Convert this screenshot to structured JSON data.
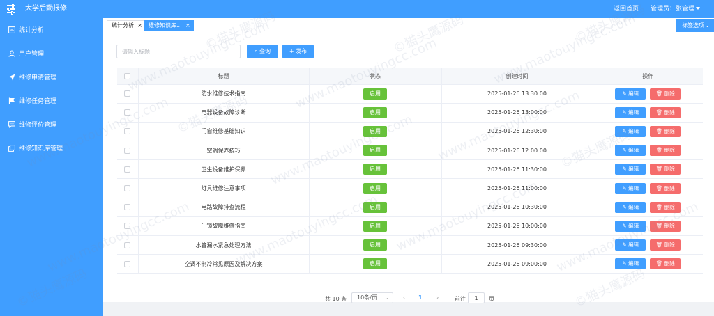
{
  "header": {
    "app_title": "大学后勤报修",
    "home_link": "返回首页",
    "user_menu": "管理员：张管理"
  },
  "sidebar": {
    "items": [
      {
        "label": "统计分析",
        "icon": "chart-box-icon"
      },
      {
        "label": "用户管理",
        "icon": "user-icon"
      },
      {
        "label": "维修申请管理",
        "icon": "send-icon"
      },
      {
        "label": "维修任务管理",
        "icon": "flag-icon"
      },
      {
        "label": "维修评价管理",
        "icon": "comment-icon"
      },
      {
        "label": "维修知识库管理",
        "icon": "copy-icon"
      }
    ]
  },
  "tabs": {
    "items": [
      {
        "label": "统计分析",
        "close": "×",
        "active": false
      },
      {
        "label": "维修知识库...",
        "close": "×",
        "active": true
      }
    ],
    "options_label": "标签选项"
  },
  "toolbar": {
    "search_placeholder": "请输入标题",
    "search_button": "查询",
    "publish_button": "发布"
  },
  "table": {
    "columns": [
      "标题",
      "状态",
      "创建时间",
      "操作"
    ],
    "edit_label": "编辑",
    "delete_label": "删除",
    "rows": [
      {
        "title": "防水维修技术指南",
        "status": "启用",
        "created": "2025-01-26 13:30:00"
      },
      {
        "title": "电器设备故障诊断",
        "status": "启用",
        "created": "2025-01-26 13:00:00"
      },
      {
        "title": "门窗维修基础知识",
        "status": "启用",
        "created": "2025-01-26 12:30:00"
      },
      {
        "title": "空调保养技巧",
        "status": "启用",
        "created": "2025-01-26 12:00:00"
      },
      {
        "title": "卫生设备维护保养",
        "status": "启用",
        "created": "2025-01-26 11:30:00"
      },
      {
        "title": "灯具维修注意事项",
        "status": "启用",
        "created": "2025-01-26 11:00:00"
      },
      {
        "title": "电路故障排查流程",
        "status": "启用",
        "created": "2025-01-26 10:30:00"
      },
      {
        "title": "门锁故障维修指南",
        "status": "启用",
        "created": "2025-01-26 10:00:00"
      },
      {
        "title": "水管漏水紧急处理方法",
        "status": "启用",
        "created": "2025-01-26 09:30:00"
      },
      {
        "title": "空调不制冷常见原因及解决方案",
        "status": "启用",
        "created": "2025-01-26 09:00:00"
      }
    ]
  },
  "pagination": {
    "total": "共 10 条",
    "page_size": "10条/页",
    "current_page": "1",
    "goto_label": "前往",
    "goto_value": "1",
    "page_suffix": "页"
  },
  "watermark": {
    "text_url": "www.maotouyingcc.com",
    "text_brand": "©猫头鹰源码"
  },
  "colors": {
    "primary": "#409eff",
    "success": "#67c23a",
    "danger": "#f56c6c"
  }
}
